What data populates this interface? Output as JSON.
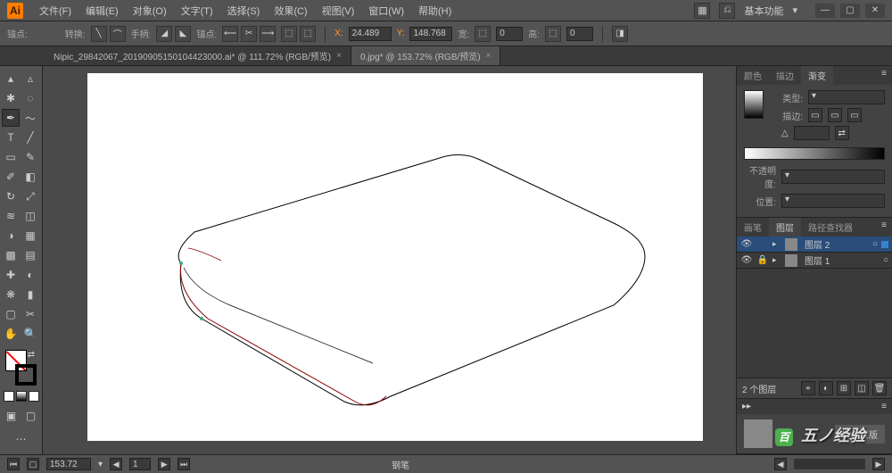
{
  "app_icon": "Ai",
  "menu": [
    "文件(F)",
    "编辑(E)",
    "对象(O)",
    "文字(T)",
    "选择(S)",
    "效果(C)",
    "视图(V)",
    "窗口(W)",
    "帮助(H)"
  ],
  "workspace": "基本功能",
  "controlbar": {
    "anchor_label": "锚点:",
    "convert_label": "转换:",
    "handle_label": "手柄:",
    "anchor2_label": "锚点:",
    "x_label": "X:",
    "x_value": "24.489",
    "y_label": "Y:",
    "y_value": "148.768",
    "w_label": "宽:",
    "w_value": "0",
    "h_label": "高:",
    "h_value": "0"
  },
  "tabs": [
    {
      "label": "Nipic_29842067_20190905150104423000.ai* @ 111.72% (RGB/预览)",
      "active": false
    },
    {
      "label": "0.jpg* @ 153.72% (RGB/预览)",
      "active": true
    }
  ],
  "panels": {
    "color_tabs": [
      "颜色",
      "描边",
      "渐变"
    ],
    "type_label": "类型:",
    "stroke_label": "描边:",
    "opacity_label": "不透明度:",
    "position_label": "位置:",
    "layer_tabs": [
      "画笔",
      "图层",
      "路径查找器"
    ],
    "layers": [
      {
        "name": "图层 2",
        "selected": true,
        "locked": false
      },
      {
        "name": "图层 1",
        "selected": false,
        "locked": true
      }
    ],
    "layer_count": "2 个图层",
    "action_button": "制作蒙版"
  },
  "statusbar": {
    "zoom": "153.72",
    "page": "1",
    "tool_name": "钢笔"
  },
  "watermark": {
    "text": "五ノ经验",
    "badge": "百"
  }
}
